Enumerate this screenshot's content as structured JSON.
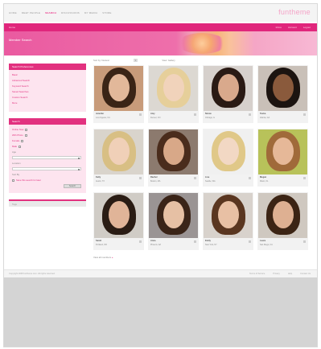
{
  "nav": {
    "tabs": [
      "Home",
      "Meet People",
      "Search",
      "Discussions",
      "My Media",
      "Store"
    ],
    "active_index": 2,
    "brand": "funtheme"
  },
  "pinkbar": {
    "home": "Home",
    "links": [
      "Inbox",
      "Account",
      "Logout"
    ]
  },
  "banner": {
    "title": "Member Search"
  },
  "sidebar": {
    "panel1": {
      "title": "Search Preferences",
      "items": [
        "Basic",
        "Advanced Search",
        "Keyword Search",
        "Saved Searches",
        "Custom Search",
        "More"
      ]
    },
    "panel2": {
      "title": "Search",
      "rows": [
        "Online Now",
        "With Photo",
        "Female",
        "Male"
      ],
      "age_label": "Age",
      "location_label": "Location",
      "sort_label": "Sort By",
      "save_label": "Save this search for later",
      "button": "Search"
    },
    "panel3": {
      "title": "Tags"
    }
  },
  "results": {
    "sort_text": "Sort by: Newest",
    "page": "1",
    "view_text": "View: Gallery",
    "members": [
      {
        "name": "Jennifer",
        "sub": "Los Angeles, CA",
        "bg": "#c89b7a",
        "hair": "#3a2416",
        "skin": "#e2b89a"
      },
      {
        "name": "Amy",
        "sub": "Denver, CO",
        "bg": "#dcd8d2",
        "hair": "#e6cf9a",
        "skin": "#f1d3bb"
      },
      {
        "name": "Nicole",
        "sub": "Chicago, IL",
        "bg": "#d6d0cc",
        "hair": "#2a1a14",
        "skin": "#d9a98c"
      },
      {
        "name": "Tasha",
        "sub": "Atlanta, GA",
        "bg": "#c9c0b8",
        "hair": "#1c1410",
        "skin": "#8a5a3c"
      },
      {
        "name": "Kelly",
        "sub": "Austin, TX",
        "bg": "#d9d4cc",
        "hair": "#d8bf84",
        "skin": "#f0d0b8"
      },
      {
        "name": "Rachel",
        "sub": "Boston, MA",
        "bg": "#8c7a6e",
        "hair": "#4a2c1c",
        "skin": "#d8a888"
      },
      {
        "name": "Lisa",
        "sub": "Seattle, WA",
        "bg": "#f0f0f0",
        "hair": "#e0c888",
        "skin": "#f2d8c4"
      },
      {
        "name": "Megan",
        "sub": "Miami, FL",
        "bg": "#b8c25a",
        "hair": "#a06a3a",
        "skin": "#e6b898"
      },
      {
        "name": "Sarah",
        "sub": "Portland, OR",
        "bg": "#d0ccc6",
        "hair": "#2a1c14",
        "skin": "#e0b498"
      },
      {
        "name": "Anna",
        "sub": "Phoenix, AZ",
        "bg": "#9a9494",
        "hair": "#3a2418",
        "skin": "#e6c0a4"
      },
      {
        "name": "Emily",
        "sub": "New York, NY",
        "bg": "#d8d2cc",
        "hair": "#5a3620",
        "skin": "#e8c0a4"
      },
      {
        "name": "Laura",
        "sub": "San Diego, CA",
        "bg": "#cfc8c0",
        "hair": "#3c2414",
        "skin": "#deb092"
      }
    ],
    "view_all": "View all members",
    "view_all_link": "»"
  },
  "footer": {
    "copy": "Copyright 2008 funtheme.com. All rights reserved.",
    "links": [
      "Terms of Service",
      "Privacy",
      "Help",
      "Contact Us"
    ]
  }
}
